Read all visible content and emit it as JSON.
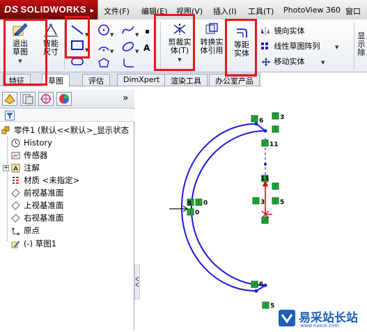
{
  "app": {
    "name": "SOLIDWORKS",
    "brand_prefix": "DS",
    "accent_red": "#c01010"
  },
  "menu": {
    "items": [
      "文件(F)",
      "编辑(E)",
      "视图(V)",
      "插入(I)",
      "工具(T)",
      "PhotoView 360",
      "窗口"
    ]
  },
  "ribbon": {
    "exit_sketch": "退出草图",
    "smart_dimension": "智能尺寸",
    "trim_entities": "剪裁实体(T)",
    "convert_entities": "转换实体引用",
    "offset_entities": "等距实体",
    "mirror_entities": "镜向实体",
    "linear_pattern": "线性草图阵列",
    "move_entities": "移动实体",
    "truncated_right": "显示",
    "truncated_right2": "除"
  },
  "tabs": {
    "items": [
      "特征",
      "草图",
      "评估",
      "DimXpert",
      "渲染工具",
      "办公室产品"
    ],
    "active_index": 1
  },
  "feature_tree": {
    "root": "零件1 (默认<<默认>_显示状态",
    "items": [
      {
        "label": "History",
        "icon": "history-icon"
      },
      {
        "label": "传感器",
        "icon": "sensor-icon"
      },
      {
        "label": "注解",
        "icon": "annotation-icon"
      },
      {
        "label": "材质 <未指定>",
        "icon": "material-icon"
      },
      {
        "label": "前视基准面",
        "icon": "plane-icon"
      },
      {
        "label": "上视基准面",
        "icon": "plane-icon"
      },
      {
        "label": "右视基准面",
        "icon": "plane-icon"
      },
      {
        "label": "原点",
        "icon": "origin-icon"
      },
      {
        "label": "(-) 草图1",
        "icon": "sketch-icon"
      }
    ],
    "expand_symbol": "»"
  },
  "sketch_labels": {
    "top_right_a": "6",
    "top_right_b": "3",
    "top_right_c": "11",
    "mid_a": "11",
    "mid_b": "3",
    "mid_c": "5",
    "left_a": "5",
    "left_b": "0",
    "left_c": "0",
    "bottom_a": "6",
    "bottom_b": "5"
  },
  "watermark": {
    "text": "易采站长站",
    "sub": "www.easck.com"
  },
  "colors": {
    "sketch_line": "#1a1ad6",
    "relation_green": "#22a83a",
    "annotation_red": "#e8151b",
    "origin_red": "#d01010"
  }
}
